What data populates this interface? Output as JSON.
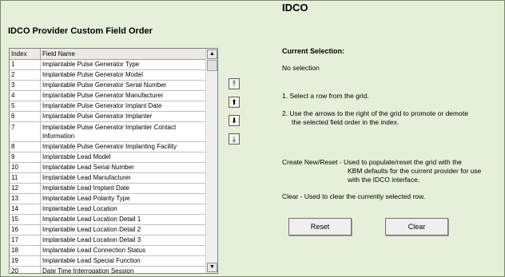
{
  "app": {
    "title": "IDCO"
  },
  "section": {
    "title": "IDCO Provider Custom Field Order"
  },
  "grid": {
    "columns": [
      "Index",
      "Field Name"
    ],
    "rows": [
      {
        "index": "1",
        "name": "Implantable Pulse Generator Type"
      },
      {
        "index": "2",
        "name": "Implantable Pulse Generator Model"
      },
      {
        "index": "3",
        "name": "Implantable Pulse Generator Serial Number"
      },
      {
        "index": "4",
        "name": "Implantable Pulse Generator Manufacturer"
      },
      {
        "index": "5",
        "name": "Implantable Pulse Generator Implant Date"
      },
      {
        "index": "6",
        "name": "Implantable Pulse Generator Implanter"
      },
      {
        "index": "7",
        "name": "Implantable Pulse Generator Implanter Contact Information"
      },
      {
        "index": "8",
        "name": "Implantable Pulse Generator Implanting Facility"
      },
      {
        "index": "9",
        "name": "Implantable Lead Model"
      },
      {
        "index": "10",
        "name": "Implantable Lead Serial Number"
      },
      {
        "index": "11",
        "name": "Implantable Lead Manufacturer"
      },
      {
        "index": "12",
        "name": "Implantable Lead Implant Date"
      },
      {
        "index": "13",
        "name": "Implantable Lead Polarity Type"
      },
      {
        "index": "14",
        "name": "Implantable Lead Location"
      },
      {
        "index": "15",
        "name": "Implantable Lead Location Detail 1"
      },
      {
        "index": "16",
        "name": "Implantable Lead Location Detail 2"
      },
      {
        "index": "17",
        "name": "Implantable Lead Location Detail 3"
      },
      {
        "index": "18",
        "name": "Implantable Lead Connection Status"
      },
      {
        "index": "19",
        "name": "Implantable Lead Special Function"
      },
      {
        "index": "20",
        "name": "Date Time Interrogation Session"
      }
    ]
  },
  "selection": {
    "label": "Current Selection:",
    "value": "No selection"
  },
  "instructions": {
    "step1": "1. Select a row from the grid.",
    "step2a": "2. Use the arrows to the right of the grid to promote or demote",
    "step2b": "the selected field order in the index.",
    "create_a": "Create New/Reset - Used to populate/reset the grid with the",
    "create_b": "KBM defaults for the current provider for use",
    "create_c": "with the IDCO interface.",
    "clear": "Clear - Used to clear the currently selected row."
  },
  "buttons": {
    "reset": "Reset",
    "clear": "Clear"
  },
  "icons": {
    "top": "arrow-to-top-icon",
    "up": "arrow-up-icon",
    "down": "arrow-down-icon",
    "bottom": "arrow-to-bottom-icon"
  }
}
